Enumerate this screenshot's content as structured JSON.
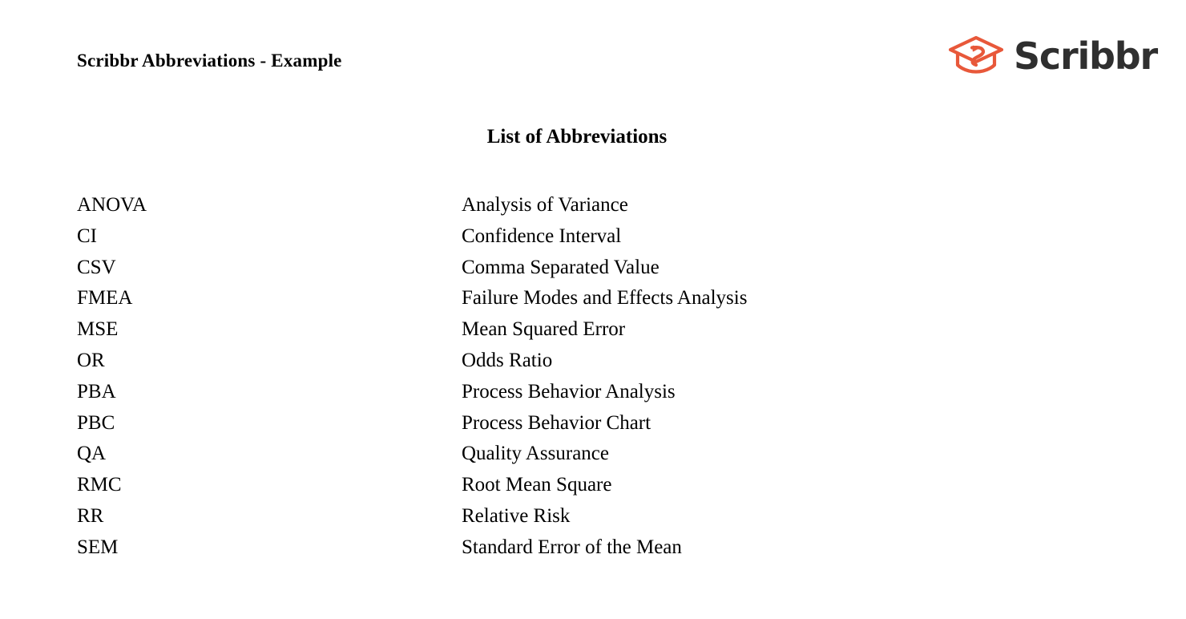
{
  "document": {
    "title": "Scribbr Abbreviations - Example",
    "heading": "List of Abbreviations",
    "background_color": "#ffffff",
    "text_color": "#000000"
  },
  "brand": {
    "name": "Scribbr",
    "icon": "graduation-cap-icon",
    "icon_color": "#E8583A",
    "wordmark_color": "#2f2f2f"
  },
  "abbreviations": [
    {
      "short": "ANOVA",
      "full": "Analysis of Variance"
    },
    {
      "short": "CI",
      "full": "Confidence Interval"
    },
    {
      "short": "CSV",
      "full": "Comma Separated Value"
    },
    {
      "short": "FMEA",
      "full": "Failure Modes and Effects Analysis"
    },
    {
      "short": "MSE",
      "full": "Mean Squared Error"
    },
    {
      "short": "OR",
      "full": "Odds Ratio"
    },
    {
      "short": "PBA",
      "full": "Process Behavior Analysis"
    },
    {
      "short": "PBC",
      "full": "Process Behavior Chart"
    },
    {
      "short": "QA",
      "full": "Quality Assurance"
    },
    {
      "short": "RMC",
      "full": "Root Mean Square"
    },
    {
      "short": "RR",
      "full": "Relative Risk"
    },
    {
      "short": "SEM",
      "full": "Standard Error of the Mean"
    }
  ]
}
